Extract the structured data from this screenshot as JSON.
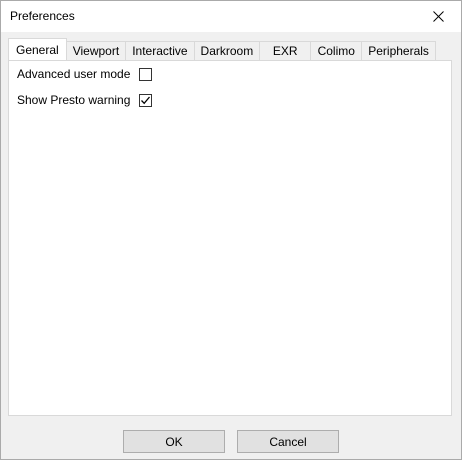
{
  "window": {
    "title": "Preferences",
    "close_icon": "close-icon"
  },
  "tabs": [
    {
      "label": "General",
      "active": true
    },
    {
      "label": "Viewport",
      "active": false
    },
    {
      "label": "Interactive",
      "active": false
    },
    {
      "label": "Darkroom",
      "active": false
    },
    {
      "label": "EXR",
      "active": false
    },
    {
      "label": "Colimo",
      "active": false
    },
    {
      "label": "Peripherals",
      "active": false
    }
  ],
  "general": {
    "advanced_user_mode": {
      "label": "Advanced user mode",
      "checked": false
    },
    "show_presto_warning": {
      "label": "Show Presto warning",
      "checked": true
    }
  },
  "buttons": {
    "ok": "OK",
    "cancel": "Cancel"
  }
}
